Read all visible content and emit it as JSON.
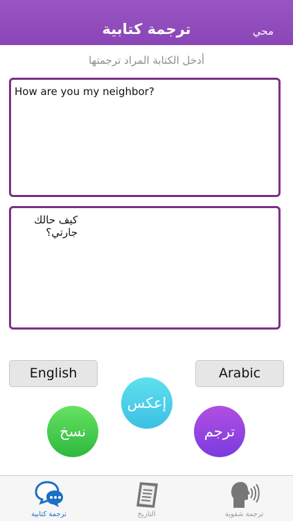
{
  "header": {
    "title": "ترجمة كتابية",
    "clear_label": "محي"
  },
  "hint": "أدخل الكتابة المراد ترجمتها",
  "input_text": "How are you my neighbor?",
  "output_text": "كيف حالك جارتي؟",
  "languages": {
    "source": "English",
    "target": "Arabic"
  },
  "buttons": {
    "swap": "إعكس",
    "copy": "نسخ",
    "translate": "ترجم"
  },
  "tabs": [
    {
      "label": "ترجمة كتابية",
      "icon": "chat-bubbles-icon"
    },
    {
      "label": "التاريخ",
      "icon": "history-document-icon"
    },
    {
      "label": "ترجمة شفوية",
      "icon": "speaking-head-icon"
    }
  ],
  "colors": {
    "header": "#8a45b6",
    "box_border": "#7a2f84",
    "active_tab": "#1b6fc4"
  }
}
